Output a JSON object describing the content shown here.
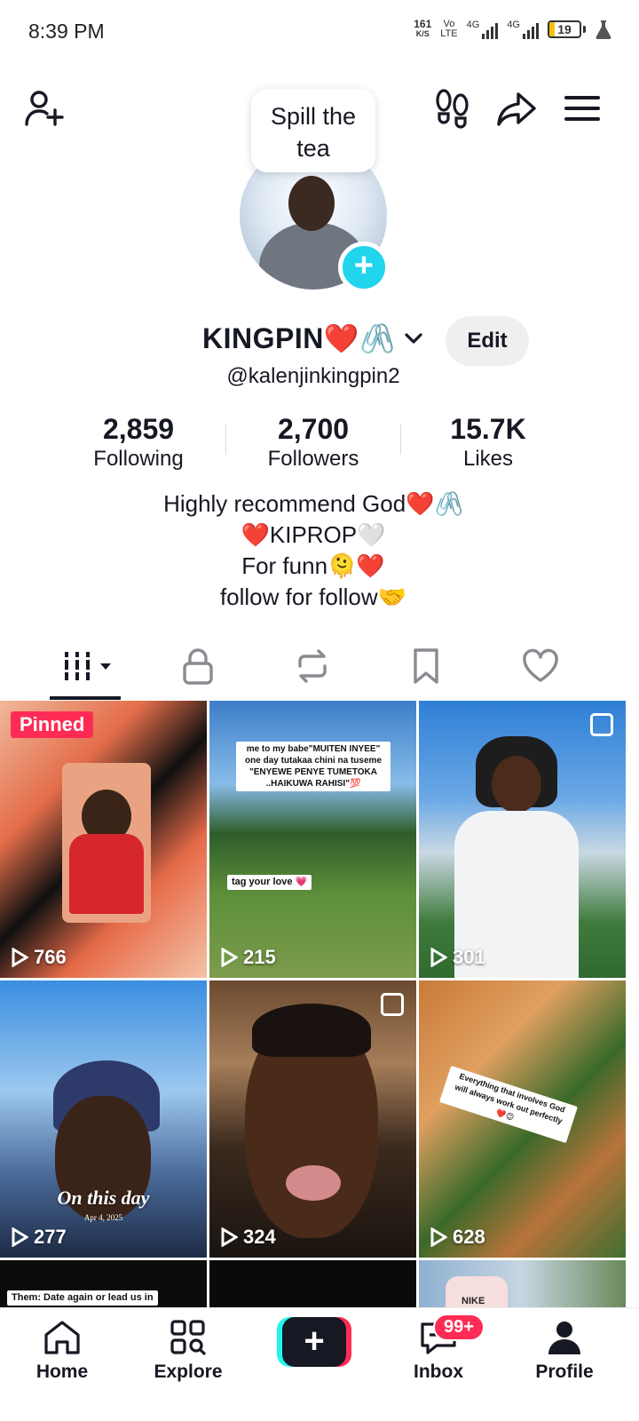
{
  "status_bar": {
    "time": "8:39 PM",
    "net_speed_value": "161",
    "net_speed_unit": "K/S",
    "volte_top": "Vo",
    "volte_bottom": "LTE",
    "sim1_label": "4G",
    "sim2_label": "4G",
    "battery_level": "19",
    "battery_fraction": 0.19
  },
  "header": {
    "add_friend_icon": "add-user-icon",
    "footprints_icon": "footprints-icon",
    "share_icon": "share-icon",
    "menu_icon": "hamburger-menu-icon"
  },
  "bubble": {
    "line1": "Spill the",
    "line2": "tea"
  },
  "profile": {
    "name": "KINGPIN❤️🖇️",
    "handle": "@kalenjinkingpin2",
    "edit_label": "Edit"
  },
  "stats": [
    {
      "value": "2,859",
      "label": "Following"
    },
    {
      "value": "2,700",
      "label": "Followers"
    },
    {
      "value": "15.7K",
      "label": "Likes"
    }
  ],
  "bio": [
    "Highly recommend God❤️🖇️",
    "❤️KIPROP🤍",
    "For funn🫠❤️",
    "follow for follow🤝"
  ],
  "tabs": [
    {
      "name": "videos-grid-icon",
      "selected": true
    },
    {
      "name": "lock-icon",
      "selected": false
    },
    {
      "name": "repost-icon",
      "selected": false
    },
    {
      "name": "bookmark-icon",
      "selected": false
    },
    {
      "name": "heart-icon",
      "selected": false
    }
  ],
  "videos": [
    {
      "views": "766",
      "pinned_label": "Pinned"
    },
    {
      "views": "215",
      "caption_top": "me to my babe\"MUITEN INYEE\" one day tutakaa chini na tuseme \"ENYEWE PENYE TUMETOKA ..HAIKUWA RAHISI\"💯",
      "caption_mid": "tag your love 💗"
    },
    {
      "views": "301"
    },
    {
      "views": "277",
      "overlay_title": "On this day",
      "overlay_date": "Apr 4, 2025"
    },
    {
      "views": "324"
    },
    {
      "views": "628",
      "caption": "Everything that involves God will always work out perfectly ❤️😊"
    },
    {
      "caption": "Them: Date again or lead us in"
    },
    {},
    {
      "shirt_text": "NIKE"
    }
  ],
  "colors": {
    "accent_red": "#fe2c55",
    "accent_cyan": "#25f4ee",
    "avatar_add": "#20d5ec",
    "text": "#161823"
  },
  "bottom_nav": {
    "home": "Home",
    "explore": "Explore",
    "create_label": "+",
    "inbox": "Inbox",
    "inbox_badge": "99+",
    "profile": "Profile"
  }
}
